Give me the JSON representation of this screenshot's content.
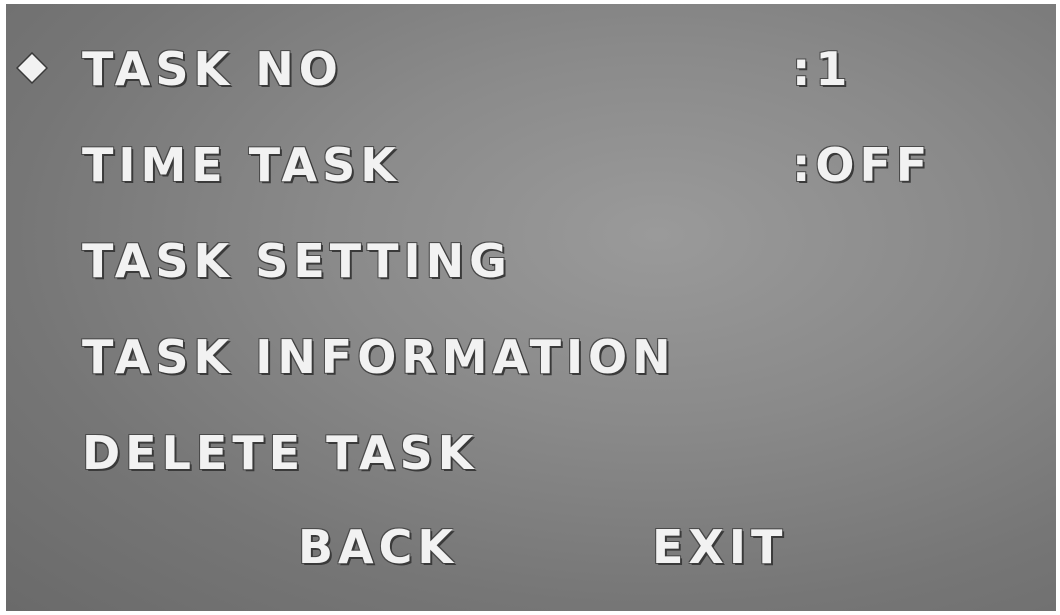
{
  "menu": {
    "items": [
      {
        "label": "TASK NO",
        "value": ":1",
        "selected": true
      },
      {
        "label": "TIME TASK",
        "value": ":OFF",
        "selected": false
      },
      {
        "label": "TASK SETTING",
        "value": "",
        "selected": false
      },
      {
        "label": "TASK INFORMATION",
        "value": "",
        "selected": false
      },
      {
        "label": "DELETE TASK",
        "value": "",
        "selected": false
      }
    ],
    "cursor_icon": "diamond-icon"
  },
  "footer": {
    "back_label": "BACK",
    "exit_label": "EXIT"
  },
  "colors": {
    "text": "#f2f2f2",
    "background": "#8a8a8a"
  }
}
